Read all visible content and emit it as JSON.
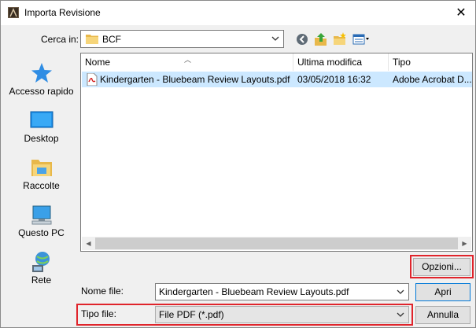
{
  "window": {
    "title": "Importa Revisione"
  },
  "toolbar": {
    "lookin_label": "Cerca in:",
    "lookin_value": "BCF",
    "icons": [
      "back-icon",
      "up-folder-icon",
      "new-folder-icon",
      "view-menu-icon"
    ]
  },
  "places": [
    {
      "label": "Accesso rapido",
      "icon": "star-icon"
    },
    {
      "label": "Desktop",
      "icon": "desktop-icon"
    },
    {
      "label": "Raccolte",
      "icon": "libraries-icon"
    },
    {
      "label": "Questo PC",
      "icon": "computer-icon"
    },
    {
      "label": "Rete",
      "icon": "network-icon"
    }
  ],
  "filelist": {
    "columns": [
      "Nome",
      "Ultima modifica",
      "Tipo"
    ],
    "rows": [
      {
        "name": "Kindergarten - Bluebeam Review Layouts.pdf",
        "modified": "03/05/2018 16:32",
        "type": "Adobe Acrobat D..."
      }
    ]
  },
  "buttons": {
    "options": "Opzioni...",
    "open": "Apri",
    "cancel": "Annulla"
  },
  "fields": {
    "filename_label": "Nome file:",
    "filename_value": "Kindergarten - Bluebeam Review Layouts.pdf",
    "filetype_label": "Tipo file:",
    "filetype_value": "File PDF (*.pdf)"
  },
  "colors": {
    "selection": "#cce8ff",
    "highlight": "#e0242b",
    "accent": "#0078d7"
  }
}
